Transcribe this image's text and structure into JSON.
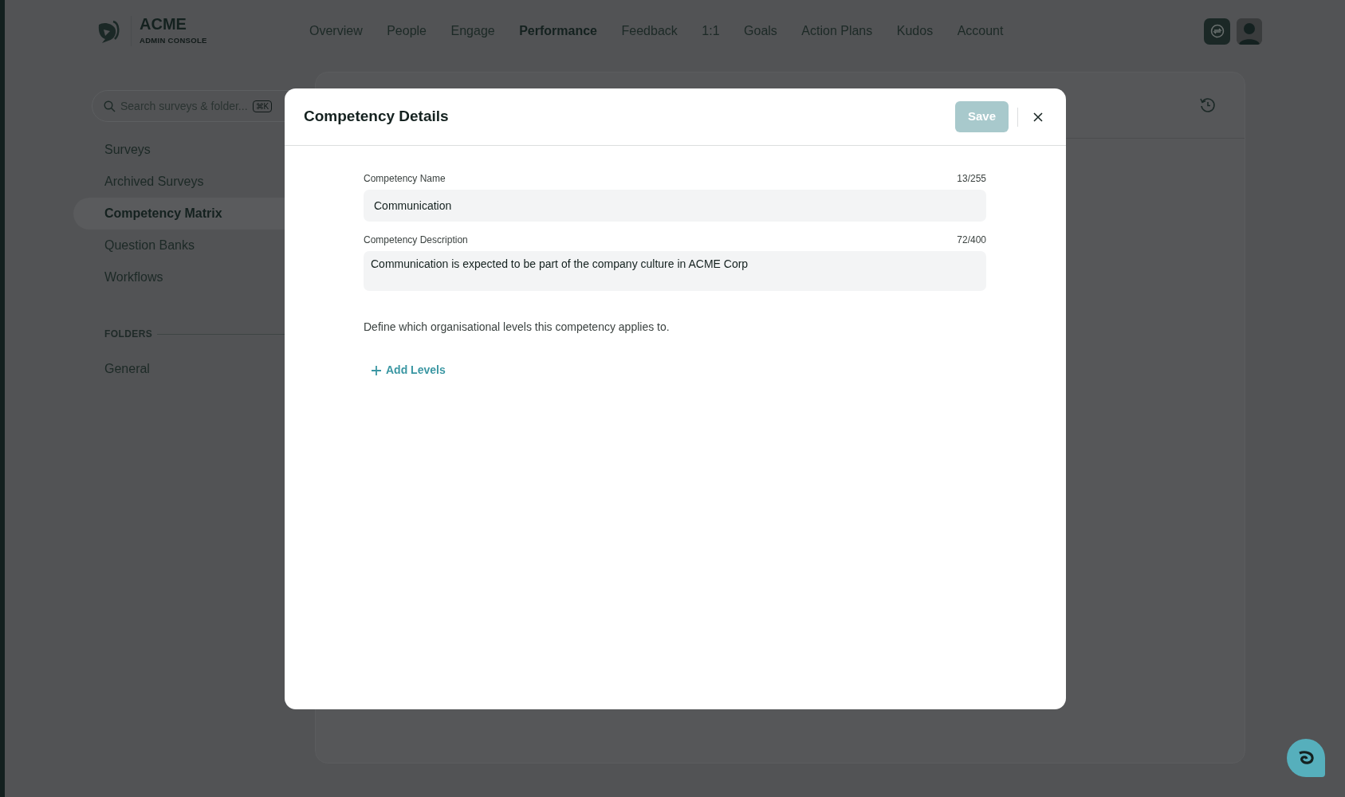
{
  "brand": {
    "name": "ACME",
    "subtitle": "ADMIN CONSOLE"
  },
  "nav": [
    {
      "label": "Overview",
      "selected": false
    },
    {
      "label": "People",
      "selected": false
    },
    {
      "label": "Engage",
      "selected": false
    },
    {
      "label": "Performance",
      "selected": true
    },
    {
      "label": "Feedback",
      "selected": false
    },
    {
      "label": "1:1",
      "selected": false
    },
    {
      "label": "Goals",
      "selected": false
    },
    {
      "label": "Action Plans",
      "selected": false
    },
    {
      "label": "Kudos",
      "selected": false
    },
    {
      "label": "Account",
      "selected": false
    }
  ],
  "sidebar": {
    "search": {
      "placeholder": "Search surveys & folder...",
      "shortcut": "⌘K"
    },
    "items": [
      {
        "label": "Surveys",
        "selected": false
      },
      {
        "label": "Archived Surveys",
        "selected": false
      },
      {
        "label": "Competency Matrix",
        "selected": true
      },
      {
        "label": "Question Banks",
        "selected": false
      },
      {
        "label": "Workflows",
        "selected": false
      }
    ],
    "folders_heading": "FOLDERS",
    "folders": [
      {
        "label": "General",
        "selected": false
      }
    ]
  },
  "modal": {
    "title": "Competency Details",
    "save": {
      "label": "Save",
      "disabled": true
    },
    "fields": [
      {
        "kind": "input",
        "label": "Competency Name",
        "counter": "13/255",
        "value": "Communication"
      },
      {
        "kind": "textarea",
        "label": "Competency Description",
        "counter": "72/400",
        "value": "Communication is expected to be part of the company culture in ACME Corp"
      }
    ],
    "help_text": "Define which organisational levels this competency applies to.",
    "add_button": "Add Levels"
  }
}
